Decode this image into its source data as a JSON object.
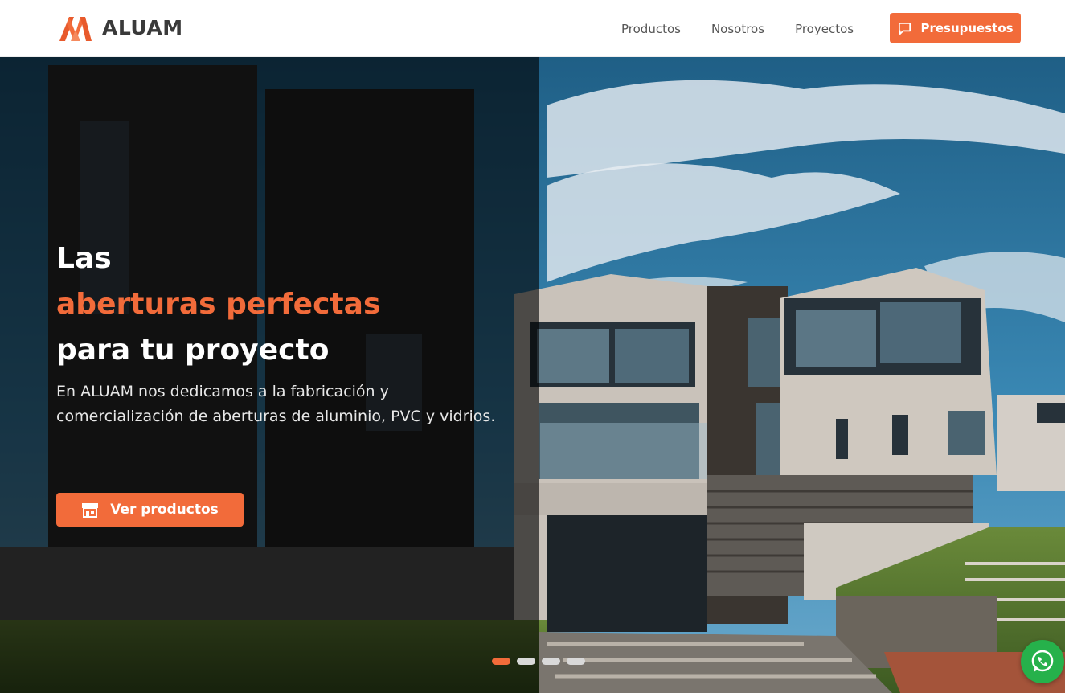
{
  "brand": {
    "name": "ALUAM",
    "logo_icon": "aluam-logo-icon"
  },
  "nav": {
    "items": [
      {
        "label": "Productos"
      },
      {
        "label": "Nosotros"
      },
      {
        "label": "Proyectos"
      }
    ],
    "cta_label": "Presupuestos",
    "cta_icon": "chat-bubble-icon"
  },
  "hero": {
    "title_line1": "Las",
    "title_line2": "aberturas perfectas",
    "title_line3": "para tu proyecto",
    "description": "En ALUAM nos dedicamos a la fabricación y comercialización de aberturas de aluminio, PVC y vidrios.",
    "button_label": "Ver productos",
    "button_icon": "store-icon",
    "slider": {
      "count": 4,
      "active_index": 0
    }
  },
  "colors": {
    "accent": "#f26b3a",
    "text_dark": "#3a3a3a",
    "nav_text": "#555555",
    "whatsapp": "#26b14b"
  },
  "whatsapp": {
    "icon": "whatsapp-icon"
  }
}
